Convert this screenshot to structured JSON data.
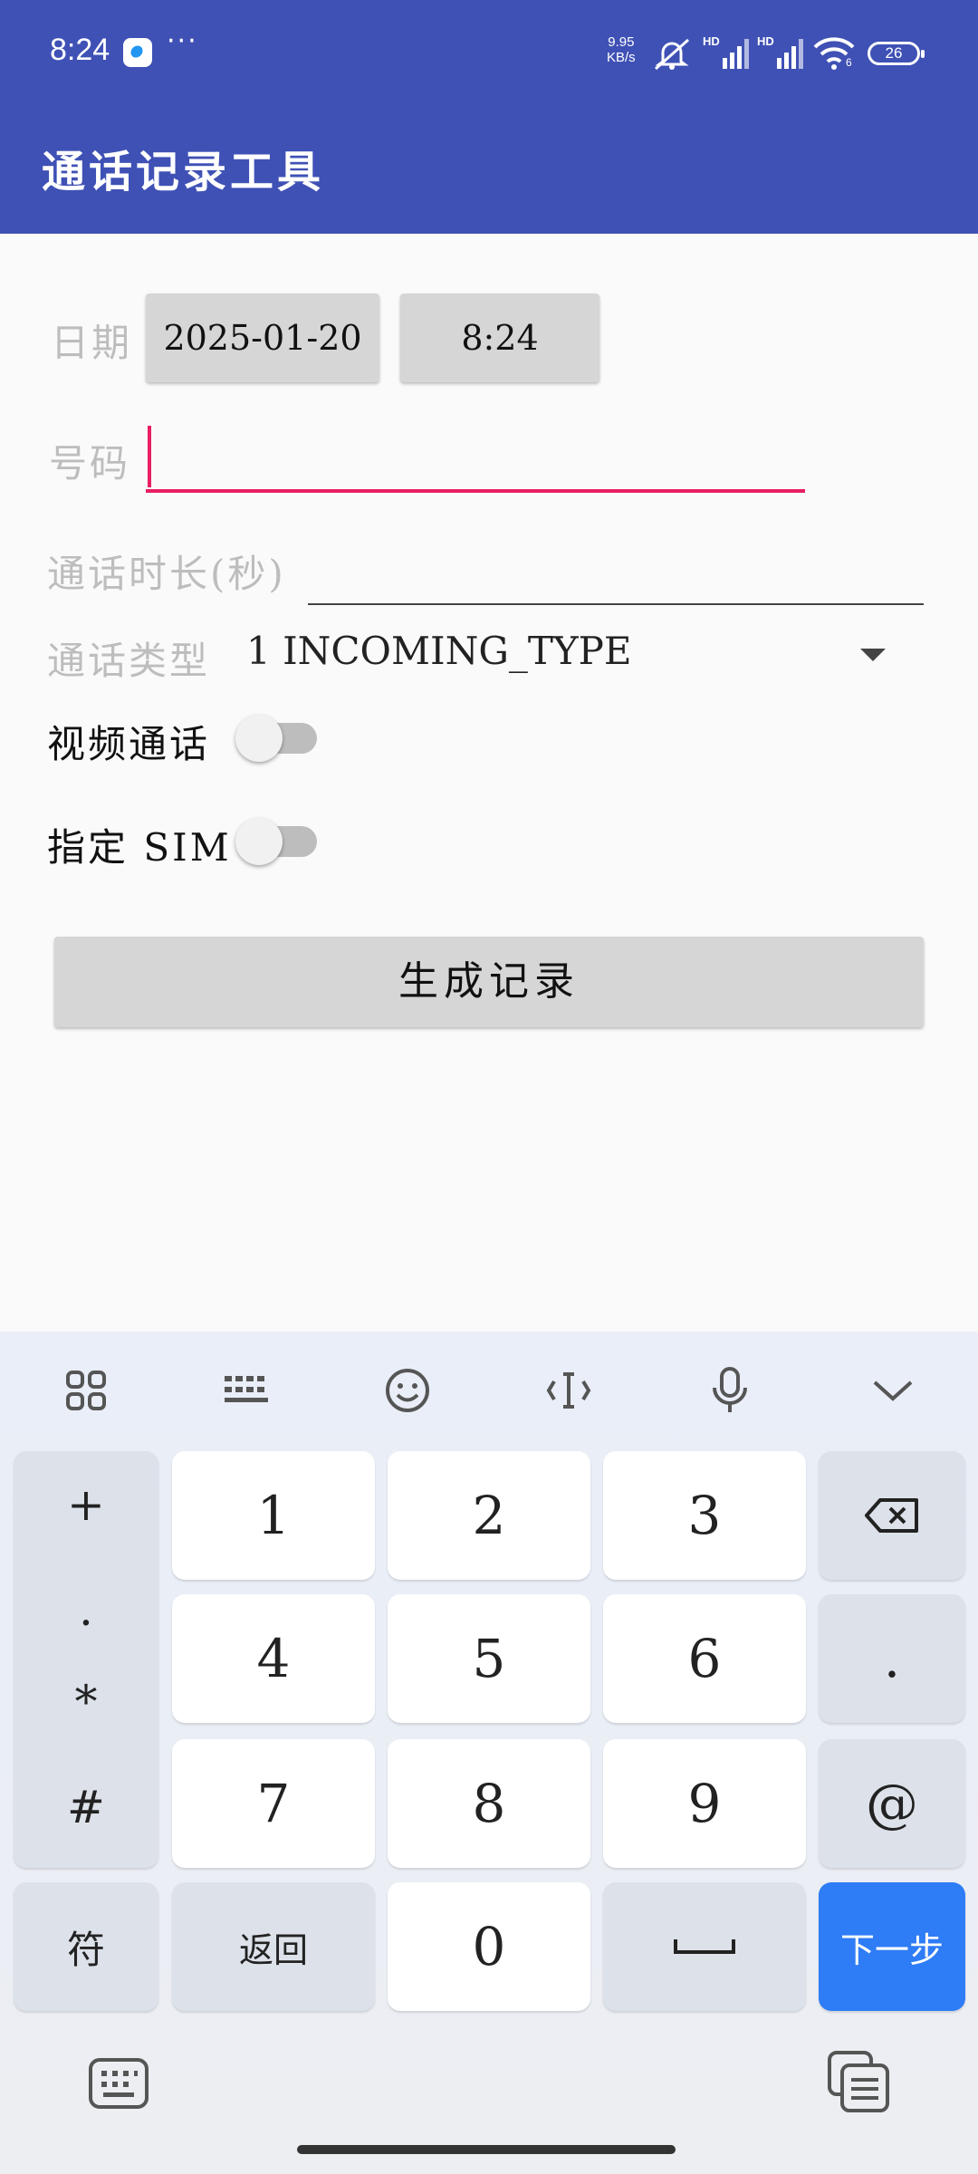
{
  "status_bar": {
    "time": "8:24",
    "more": "···",
    "speed_value": "9.95",
    "speed_unit": "KB/s",
    "battery": "26",
    "wifi_badge": "6",
    "hd_label": "HD"
  },
  "app_bar": {
    "title": "通话记录工具"
  },
  "form": {
    "date_label": "日期",
    "date_value": "2025-01-20",
    "time_value": "8:24",
    "number_label": "号码",
    "number_value": "",
    "duration_hint": "通话时长(秒)",
    "call_type_label": "通话类型",
    "call_type_value": "1 INCOMING_TYPE",
    "video_call_label": "视频通话",
    "video_call_on": false,
    "sim_label": "指定 SIM",
    "sim_on": false,
    "generate_button": "生成记录"
  },
  "keyboard": {
    "toolbar_icons": [
      "apps-grid-icon",
      "keyboard-layout-icon",
      "emoji-icon",
      "cursor-icon",
      "microphone-icon",
      "collapse-icon"
    ],
    "side_symbols": [
      "+",
      ".",
      "*",
      "#"
    ],
    "digits": [
      "1",
      "2",
      "3",
      "4",
      "5",
      "6",
      "7",
      "8",
      "9",
      "0"
    ],
    "dot": ".",
    "at": "@",
    "symbol_key": "符",
    "back_key": "返回",
    "next_key": "下一步",
    "colors": {
      "accent": "#2e7cf6",
      "app_bar": "#3f51b5",
      "input_accent": "#e91e63"
    }
  }
}
